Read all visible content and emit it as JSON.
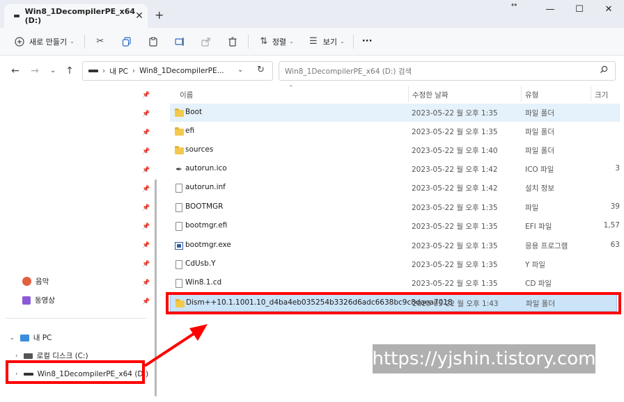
{
  "window": {
    "tab_title": "Win8_1DecompilerPE_x64 (D:)",
    "tab_close": "✕",
    "new_tab": "+",
    "minimize": "—",
    "maximize": "☐",
    "close": "✕",
    "drag": "↔"
  },
  "toolbar": {
    "new_label": "새로 만들기",
    "sort_label": "정렬",
    "view_label": "보기",
    "more_label": "···"
  },
  "address": {
    "root": "내 PC",
    "current": "Win8_1DecompilerPE...",
    "search_placeholder": "Win8_1DecompilerPE_x64 (D:) 검색"
  },
  "columns": {
    "name": "이름",
    "modified": "수정한 날짜",
    "type": "유형",
    "size": "크기"
  },
  "files": [
    {
      "name": "Boot",
      "date": "2023-05-22 월 오후 1:35",
      "type": "파일 폴더",
      "size": "",
      "icon": "folder"
    },
    {
      "name": "efi",
      "date": "2023-05-22 월 오후 1:35",
      "type": "파일 폴더",
      "size": "",
      "icon": "folder"
    },
    {
      "name": "sources",
      "date": "2023-05-22 월 오후 1:40",
      "type": "파일 폴더",
      "size": "",
      "icon": "folder"
    },
    {
      "name": "autorun.ico",
      "date": "2023-05-22 월 오후 1:42",
      "type": "ICO 파일",
      "size": "3",
      "icon": "ico"
    },
    {
      "name": "autorun.inf",
      "date": "2023-05-22 월 오후 1:42",
      "type": "설치 정보",
      "size": "",
      "icon": "inf"
    },
    {
      "name": "BOOTMGR",
      "date": "2023-05-22 월 오후 1:35",
      "type": "파일",
      "size": "39",
      "icon": "doc"
    },
    {
      "name": "bootmgr.efi",
      "date": "2023-05-22 월 오후 1:35",
      "type": "EFI 파일",
      "size": "1,57",
      "icon": "doc"
    },
    {
      "name": "bootmgr.exe",
      "date": "2023-05-22 월 오후 1:35",
      "type": "응용 프로그램",
      "size": "63",
      "icon": "exe"
    },
    {
      "name": "CdUsb.Y",
      "date": "2023-05-22 월 오후 1:35",
      "type": "Y 파일",
      "size": "",
      "icon": "doc"
    },
    {
      "name": "Win8.1.cd",
      "date": "2023-05-22 월 오후 1:35",
      "type": "CD 파일",
      "size": "",
      "icon": "doc"
    },
    {
      "name": "Dism++10.1.1001.10_d4ba4eb035254b3326d6adc6638bc9c8daea7018",
      "date": "2023-05-22 월 오후 1:43",
      "type": "파일 폴더",
      "size": "",
      "icon": "folder"
    }
  ],
  "sidebar": {
    "music": "음악",
    "videos": "동영상",
    "this_pc": "내 PC",
    "local_disk": "로컬 디스크 (C:)",
    "drive_d": "Win8_1DecompilerPE_x64 (D:)"
  },
  "watermark": "https://yjshin.tistory.com",
  "colors": {
    "accent_red": "#ff0000",
    "selection": "#cce4f7",
    "folder": "#f2c94c"
  }
}
